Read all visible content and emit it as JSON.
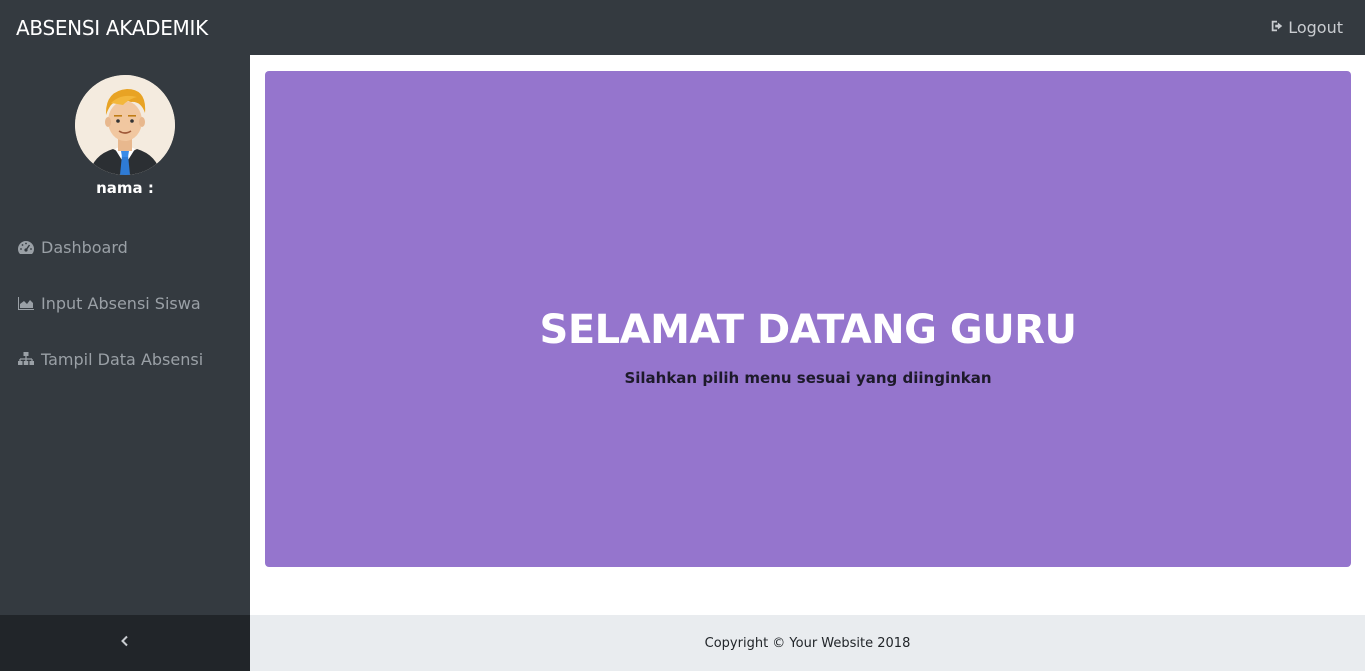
{
  "header": {
    "brand": "ABSENSI AKADEMIK",
    "logout_label": "Logout"
  },
  "sidebar": {
    "username_label": "nama :",
    "items": [
      {
        "label": "Dashboard",
        "icon": "tachometer-icon"
      },
      {
        "label": "Input Absensi Siswa",
        "icon": "area-chart-icon"
      },
      {
        "label": "Tampil Data Absensi",
        "icon": "sitemap-icon"
      }
    ],
    "toggle_icon": "chevron-left-icon"
  },
  "main": {
    "title": "SELAMAT DATANG GURU",
    "subtitle": "Silahkan pilih menu sesuai yang diinginkan"
  },
  "footer": {
    "copyright": "Copyright © Your Website 2018"
  },
  "colors": {
    "topbar_bg": "#343a40",
    "sidebar_bg": "#343a40",
    "toggle_bg": "#212529",
    "jumbotron_bg": "#9575cd",
    "footer_bg": "#e9ecef",
    "nav_text": "#9aa0a6"
  }
}
